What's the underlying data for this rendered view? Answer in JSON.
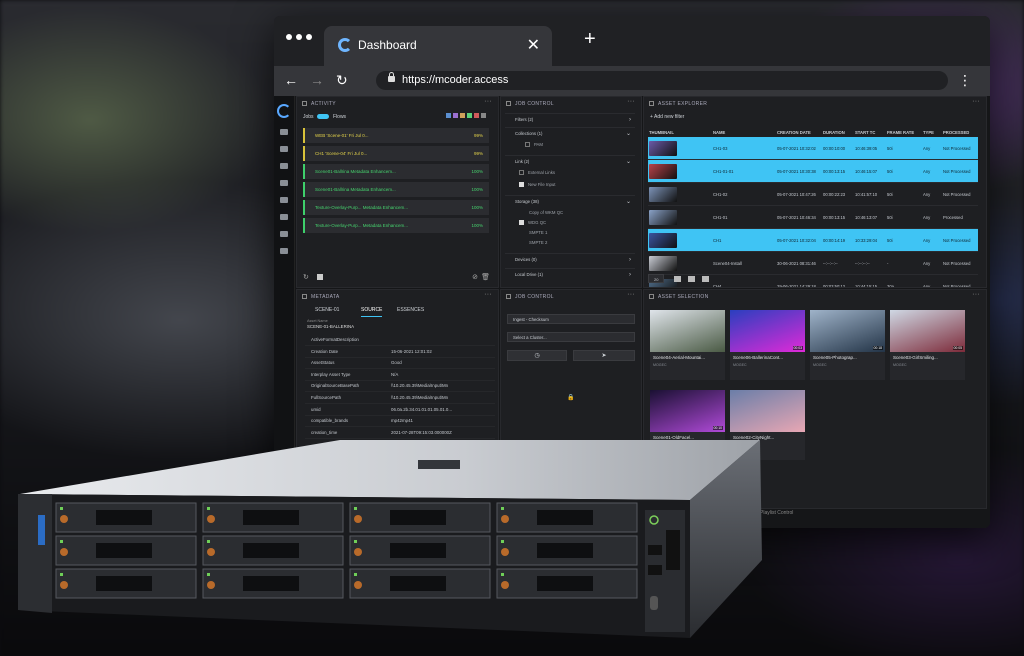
{
  "browser": {
    "tab_title": "Dashboard",
    "url": "https://mcoder.access"
  },
  "activity": {
    "header": "ACTIVITY",
    "toggle_left": "Jobs",
    "toggle_right": "Flows",
    "rows": [
      {
        "label": "WEB 'Scene-01' Fri Jul 0...",
        "pct": "99%",
        "state": "yellow"
      },
      {
        "label": "CH1 'Scene-04' Fri Jul 0...",
        "pct": "99%",
        "state": "yellow"
      },
      {
        "label": "Scene01-Ballrina Metadata Enhancem...",
        "pct": "100%",
        "state": "green"
      },
      {
        "label": "Scene01-Ballrina Metadata Enhancem...",
        "pct": "100%",
        "state": "green"
      },
      {
        "label": "Texture-Overlay-Purp... Metadata Enhancem...",
        "pct": "100%",
        "state": "green"
      },
      {
        "label": "Texture-Overlay-Purp... Metadata Enhancem...",
        "pct": "100%",
        "state": "green"
      }
    ]
  },
  "job_control_top": {
    "header": "JOB CONTROL",
    "rows": [
      {
        "label": "Filters (2)",
        "type": "section"
      },
      {
        "label": "Collections (1)",
        "type": "section"
      },
      {
        "label": "PAM",
        "type": "check"
      },
      {
        "label": "Link (2)",
        "type": "section"
      },
      {
        "label": "External Links",
        "type": "check"
      },
      {
        "label": "New File Input",
        "type": "check-on"
      },
      {
        "label": "Storage (38)",
        "type": "section"
      },
      {
        "label": "Copy of WKM QC",
        "type": "item"
      },
      {
        "label": "WDG QC",
        "type": "check-on"
      },
      {
        "label": "SMPTE 1",
        "type": "item"
      },
      {
        "label": "SMPTE 2",
        "type": "item"
      },
      {
        "label": "Devices (0)",
        "type": "section"
      },
      {
        "label": "Local Drive (1)",
        "type": "section"
      }
    ]
  },
  "asset_explorer": {
    "header": "ASSET EXPLORER",
    "add_filter": "+ Add new filter",
    "columns": [
      "THUMBNAIL",
      "NAME",
      "CREATION DATE",
      "DURATION",
      "START TC",
      "FRAME RATE",
      "TYPE",
      "PROCESSED"
    ],
    "rows": [
      {
        "name": "CH1-03",
        "date": "05-07-2021 10:32:02",
        "duration": "00:00:10:00",
        "start": "10:46:39:05",
        "fr": "50i",
        "type": "Any",
        "processed": "Not Processed",
        "selected": true,
        "color": "#6b5aa8"
      },
      {
        "name": "CH1-01-01",
        "date": "05-07-2021 10:30:38",
        "duration": "00:00:13:15",
        "start": "10:46:15:07",
        "fr": "50i",
        "type": "Any",
        "processed": "Not Processed",
        "selected": true,
        "color": "#b8424a"
      },
      {
        "name": "CH1-02",
        "date": "05-07-2021 10:47:26",
        "duration": "00:00:22:23",
        "start": "10:41:57:10",
        "fr": "50i",
        "type": "Any",
        "processed": "Not Processed",
        "selected": false,
        "color": "#7d93b8"
      },
      {
        "name": "CH1-01",
        "date": "05-07-2021 10:46:34",
        "duration": "00:00:13:15",
        "start": "10:46:13:07",
        "fr": "50i",
        "type": "Any",
        "processed": "Processed",
        "selected": false,
        "color": "#8aa2c8"
      },
      {
        "name": "CH1",
        "date": "05-07-2021 10:32:04",
        "duration": "00:00:14:19",
        "start": "10:33:29:04",
        "fr": "50i",
        "type": "Any",
        "processed": "Not Processed",
        "selected": true,
        "color": "#3a55a0"
      },
      {
        "name": "Scene04-Install",
        "date": "30-06-2021 08:31:46",
        "duration": "--:--:--:--",
        "start": "--:--:--:--",
        "fr": "-",
        "type": "Any",
        "processed": "Not Processed",
        "selected": false,
        "color": "#c9ccd4"
      },
      {
        "name": "CH4",
        "date": "29-06-2021 14:29:18",
        "duration": "00:03:50:12",
        "start": "10:44:15:15",
        "fr": "30a",
        "type": "Any",
        "processed": "Not Processed",
        "selected": false,
        "color": "#4f6d8a"
      }
    ],
    "page_size": "20"
  },
  "metadata": {
    "header": "METADATA",
    "tabs": [
      "SCENE-01",
      "SOURCE",
      "ESSENCES"
    ],
    "asset_name_label": "Asset Name",
    "asset_name": "SCENE-01-BALLERINA",
    "rows": [
      {
        "k": "ActiveFormatDescription",
        "v": ""
      },
      {
        "k": "Creation Date",
        "v": "15-06-2021 12:01:02"
      },
      {
        "k": "AssetStatus",
        "v": "Good"
      },
      {
        "k": "Interplay Asset Type",
        "v": "N/A"
      },
      {
        "k": "OriginalSourceBasePath",
        "v": "\\\\10.20.45.39\\Media\\Input\\Mn"
      },
      {
        "k": "FullSourcePath",
        "v": "\\\\10.20.45.39\\Media\\Input\\Mn"
      },
      {
        "k": "umid",
        "v": "06.0a.2b.34.01.01.01.05.01.0..."
      },
      {
        "k": "compatible_brands",
        "v": "mp42mp41"
      },
      {
        "k": "creation_time",
        "v": "2021-07-28T09:15:03.000000Z"
      }
    ]
  },
  "job_control_bottom": {
    "header": "JOB CONTROL",
    "select1": "Ingest - Checksum",
    "select2": "Select a Cluster..."
  },
  "asset_selection": {
    "header": "ASSET SELECTION",
    "cards": [
      {
        "title": "Scene04-Aerial-Mountai...",
        "sub": "MOGEC",
        "dur": "",
        "c1": "#dfe4ea",
        "c2": "#4a5a44"
      },
      {
        "title": "Scene06-BallerinaCont...",
        "sub": "MOGEC",
        "dur": "00:03",
        "c1": "#2a3fbf",
        "c2": "#e02ad8"
      },
      {
        "title": "Scene05-Photograp...",
        "sub": "MOGEC",
        "dur": "00:18",
        "c1": "#9fb3c9",
        "c2": "#233447"
      },
      {
        "title": "Scene03-GirlSmiling...",
        "sub": "MOGEC",
        "dur": "00:05",
        "c1": "#cfd8e4",
        "c2": "#7d2b3a"
      },
      {
        "title": "Scene01-OldFacel...",
        "sub": "MOGEC",
        "dur": "00:10",
        "c1": "#1a1033",
        "c2": "#b04ad8"
      },
      {
        "title": "Scene02-CityNight...",
        "sub": "MOGEC",
        "dur": "",
        "c1": "#6b7ea8",
        "c2": "#e8a7b4"
      }
    ]
  },
  "footer": {
    "label": "Playlist Control"
  },
  "colors": {
    "accent": "#3fc4f4",
    "green": "#46d36e",
    "yellow": "#e4d34a"
  }
}
